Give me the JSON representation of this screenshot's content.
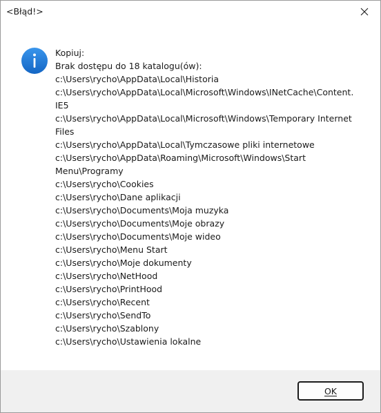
{
  "window": {
    "title": "<Błąd!>"
  },
  "icons": {
    "close": "close-icon",
    "info": "info-icon"
  },
  "colors": {
    "info_icon_fill": "#1e78d6",
    "footer_bg": "#f0f0f0"
  },
  "message": {
    "lines": [
      "Kopiuj:",
      "Brak dostępu do 18 katalogu(ów):",
      "c:\\Users\\rycho\\AppData\\Local\\Historia",
      "c:\\Users\\rycho\\AppData\\Local\\Microsoft\\Windows\\INetCache\\Content.",
      "IE5",
      "c:\\Users\\rycho\\AppData\\Local\\Microsoft\\Windows\\Temporary Internet",
      "Files",
      "c:\\Users\\rycho\\AppData\\Local\\Tymczasowe pliki internetowe",
      "c:\\Users\\rycho\\AppData\\Roaming\\Microsoft\\Windows\\Start",
      "Menu\\Programy",
      "c:\\Users\\rycho\\Cookies",
      "c:\\Users\\rycho\\Dane aplikacji",
      "c:\\Users\\rycho\\Documents\\Moja muzyka",
      "c:\\Users\\rycho\\Documents\\Moje obrazy",
      "c:\\Users\\rycho\\Documents\\Moje wideo",
      "c:\\Users\\rycho\\Menu Start",
      "c:\\Users\\rycho\\Moje dokumenty",
      "c:\\Users\\rycho\\NetHood",
      "c:\\Users\\rycho\\PrintHood",
      "c:\\Users\\rycho\\Recent",
      "c:\\Users\\rycho\\SendTo",
      "c:\\Users\\rycho\\Szablony",
      "c:\\Users\\rycho\\Ustawienia lokalne"
    ]
  },
  "buttons": {
    "ok_label": "OK"
  }
}
